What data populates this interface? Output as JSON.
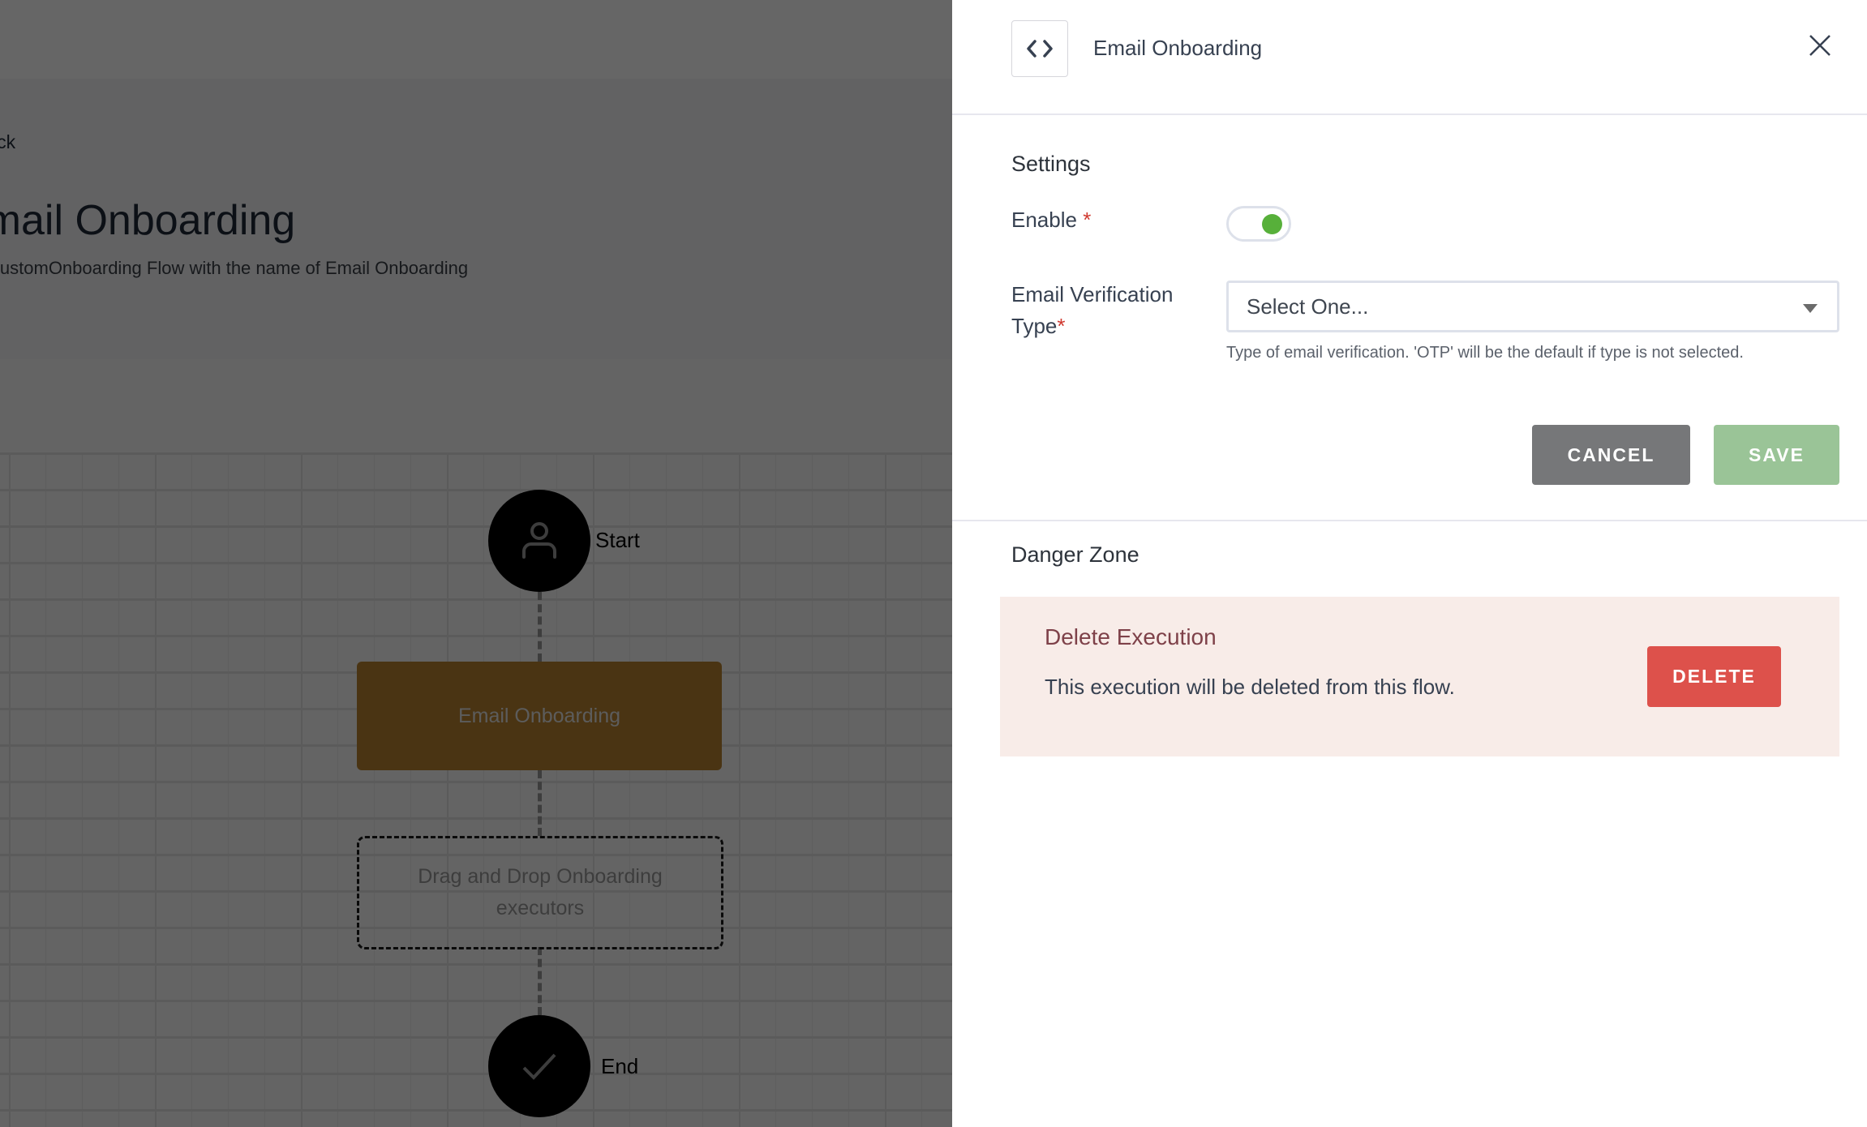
{
  "background_page": {
    "back_link": "Back",
    "page_title": "Email Onboarding",
    "page_subtitle": "Edit CustomOnboarding Flow with the name of Email Onboarding"
  },
  "flow": {
    "start": {
      "label": "Start",
      "icon": "user-icon"
    },
    "executor": {
      "label": "Email Onboarding",
      "color": "#b88330"
    },
    "dropzone": {
      "label": "Drag and Drop Onboarding executors"
    },
    "end": {
      "label": "End",
      "icon": "check-icon"
    }
  },
  "drawer": {
    "icon": "code-icon",
    "title": "Email Onboarding",
    "close_icon": "close-icon",
    "settings": {
      "title": "Settings",
      "enable": {
        "label": "Enable",
        "required_mark": "*",
        "value": true,
        "accent": "#57b03a"
      },
      "email_verification_type": {
        "label_line1": "Email Verification",
        "label_line2": "Type",
        "required_mark": "*",
        "selected": "Select One...",
        "help": "Type of email verification. 'OTP' will be the default if type is not selected."
      },
      "cancel_label": "CANCEL",
      "save_label": "SAVE"
    },
    "danger_zone": {
      "title": "Danger Zone",
      "card_title": "Delete Execution",
      "card_description": "This execution will be deleted from this flow.",
      "delete_label": "DELETE",
      "delete_color": "#dd514b"
    }
  }
}
